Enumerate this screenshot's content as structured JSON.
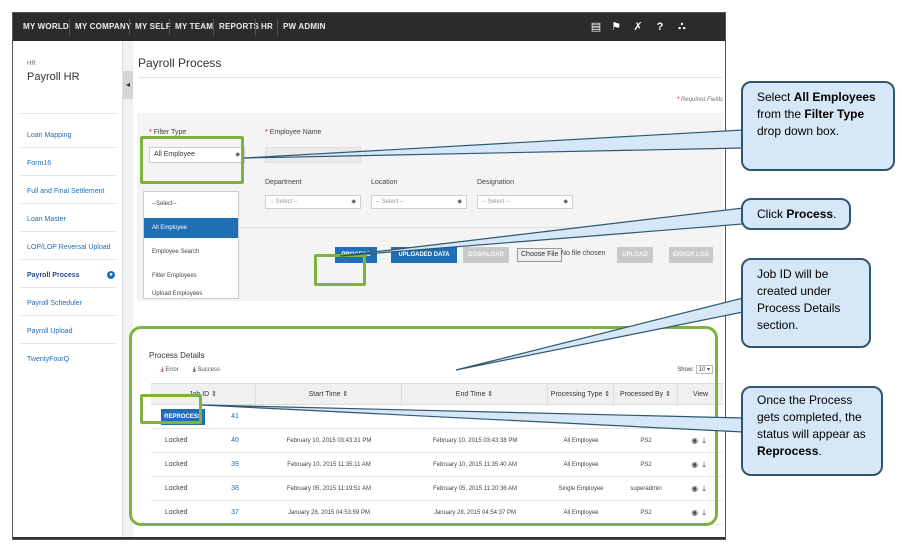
{
  "topnav": {
    "items": [
      "MY WORLD",
      "MY COMPANY",
      "MY SELF",
      "MY TEAM",
      "REPORTS",
      "HR",
      "PW ADMIN"
    ],
    "icons": [
      "book-icon",
      "flag-icon",
      "tools-icon",
      "help-icon",
      "network-icon"
    ]
  },
  "sidebar": {
    "module_label": "HR",
    "module_title": "Payroll HR",
    "items": [
      {
        "label": "Loan Mapping"
      },
      {
        "label": "Form16"
      },
      {
        "label": "Full and Final Settlement"
      },
      {
        "label": "Loan Master"
      },
      {
        "label": "LOP/LOP Reversal Upload"
      },
      {
        "label": "Payroll Process"
      },
      {
        "label": "Payroll Scheduler"
      },
      {
        "label": "Payroll Upload"
      },
      {
        "label": "TwentyFourQ"
      }
    ]
  },
  "page": {
    "title": "Payroll Process",
    "required_note": "Required Fields"
  },
  "filter": {
    "filter_type_label": "Filter Type",
    "filter_type_value": "All Employee",
    "employee_name_label": "Employee Name",
    "department_label": "Department",
    "location_label": "Location",
    "designation_label": "Designation",
    "select_placeholder": "-- Select --",
    "dropdown_options": [
      "--Select--",
      "All Employee",
      "Employee Search",
      "Filter Employees",
      "Upload Employees"
    ]
  },
  "actions": {
    "process": "PROCESS",
    "uploaded_data": "UPLOADED DATA",
    "download": "DOWNLOAD",
    "choose_file": "Choose File",
    "no_file": "No file chosen",
    "upload": "UPLOAD",
    "error_log": "ERROR LOG"
  },
  "process_details": {
    "title": "Process Details",
    "error_label": "Error",
    "success_label": "Success",
    "show_label": "Show:",
    "show_value": "10",
    "columns": [
      "Job ID",
      "Start Time",
      "End Time",
      "Processing Type",
      "Processed By",
      "View"
    ],
    "reprocess_label": "REPROCESS",
    "rows": [
      {
        "status": "",
        "job_id": "41",
        "start": "",
        "end": "",
        "type": "",
        "by": ""
      },
      {
        "status": "Locked",
        "job_id": "40",
        "start": "February 10, 2015 03:43:31 PM",
        "end": "February 10, 2015 03:43:38 PM",
        "type": "All Employee",
        "by": "PS2"
      },
      {
        "status": "Locked",
        "job_id": "39",
        "start": "February 10, 2015 11:35:11 AM",
        "end": "February 10, 2015 11:35:40 AM",
        "type": "All Employee",
        "by": "PS2"
      },
      {
        "status": "Locked",
        "job_id": "38",
        "start": "February 05, 2015 11:19:51 AM",
        "end": "February 05, 2015 11:20:36 AM",
        "type": "Single Employee",
        "by": "superadmin"
      },
      {
        "status": "Locked",
        "job_id": "37",
        "start": "January 28, 2015 04:53:59 PM",
        "end": "January 28, 2015 04:54:37 PM",
        "type": "All Employee",
        "by": "PS2"
      }
    ]
  },
  "callouts": {
    "c1": {
      "p1": "Select ",
      "b1": "All Employees",
      "p2": " from the ",
      "b2": "Filter Type",
      "p3": " drop down box."
    },
    "c2": {
      "p1": "Click ",
      "b1": "Process",
      "p2": "."
    },
    "c3": {
      "p1": "Job ID will be created under Process Details section."
    },
    "c4": {
      "p1": "Once the Process gets completed, the status will appear as ",
      "b1": "Reprocess",
      "p2": "."
    }
  },
  "colors": {
    "highlight": "#7fb23f",
    "primary_button": "#1f6fb5",
    "callout_fill": "#d6e8f7",
    "callout_border": "#2f5870",
    "nav_bg": "#2b2b2b"
  }
}
